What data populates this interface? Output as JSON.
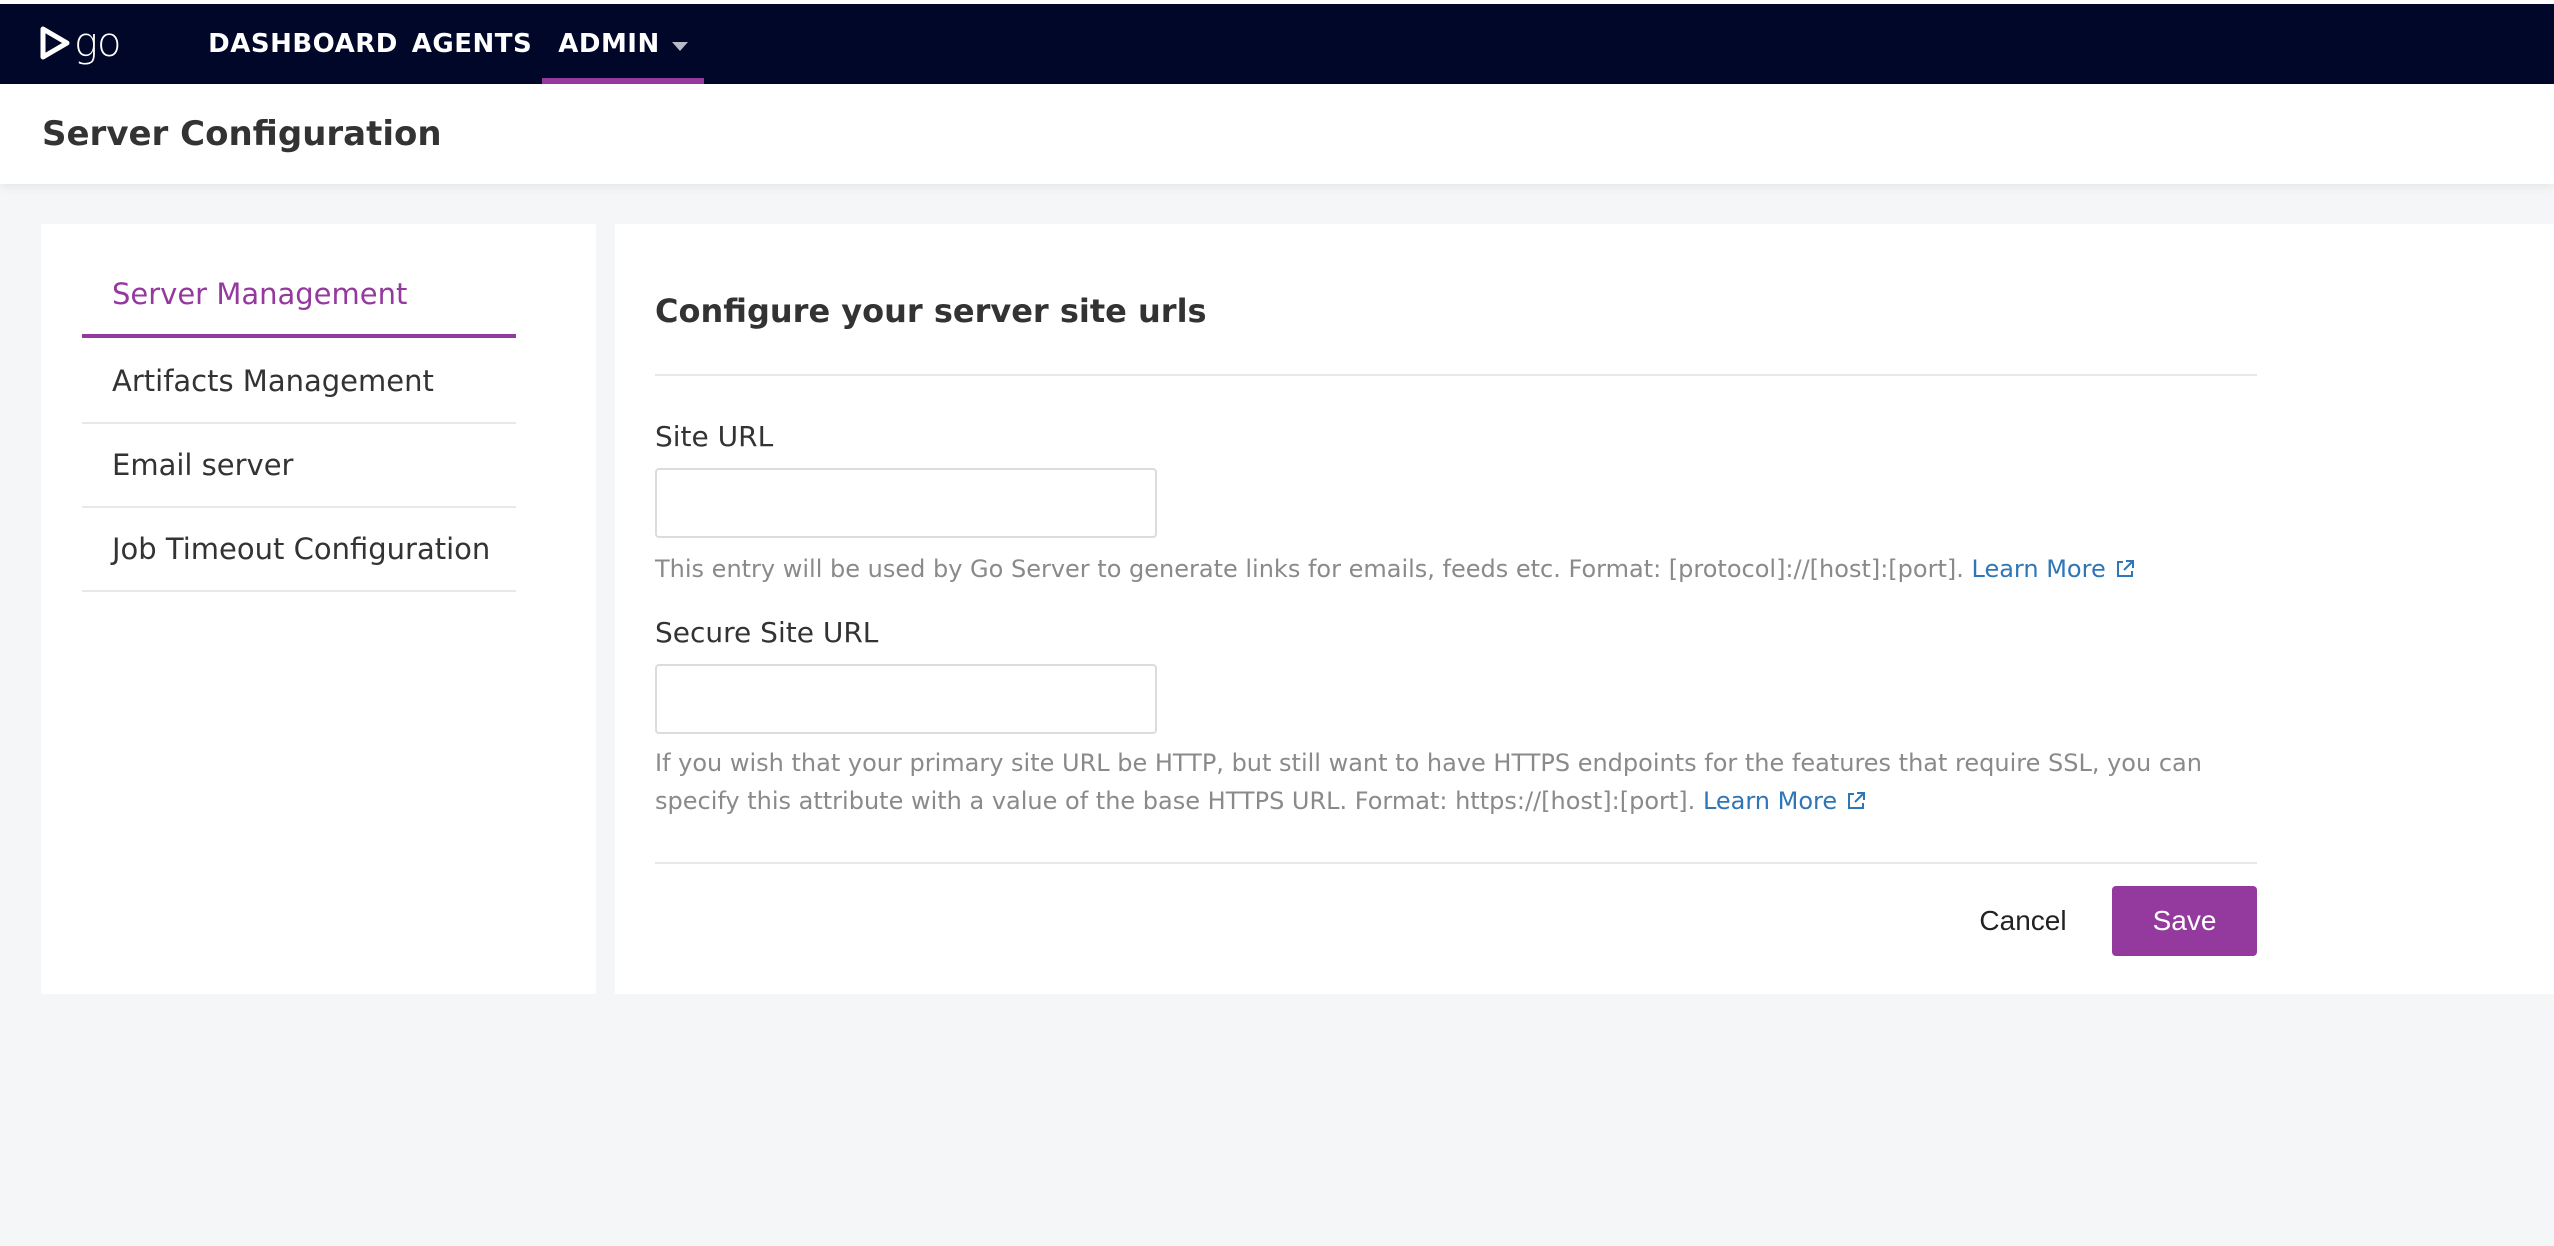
{
  "app": {
    "logo_text": "go",
    "nav": [
      {
        "label": "DASHBOARD"
      },
      {
        "label": "AGENTS"
      },
      {
        "label": "ADMIN"
      }
    ]
  },
  "header": {
    "title": "Server Configuration"
  },
  "sidebar": {
    "items": [
      {
        "label": "Server Management",
        "active": true
      },
      {
        "label": "Artifacts Management"
      },
      {
        "label": "Email server"
      },
      {
        "label": "Job Timeout Configuration"
      }
    ]
  },
  "panel": {
    "title": "Configure your server site urls",
    "site_url": {
      "label": "Site URL",
      "value": "",
      "help": "This entry will be used by Go Server to generate links for emails, feeds etc. Format: [protocol]://[host]:[port].",
      "link": "Learn More"
    },
    "secure_site_url": {
      "label": "Secure Site URL",
      "value": "",
      "help": "If you wish that your primary site URL be HTTP, but still want to have HTTPS endpoints for the features that require SSL, you can specify this attribute with a value of the base HTTPS URL. Format: https://[host]:[port].",
      "link": "Learn More"
    },
    "actions": {
      "cancel": "Cancel",
      "save": "Save"
    }
  },
  "colors": {
    "topbar": "#000728",
    "accent": "#943a9e",
    "link": "#2e76b6"
  }
}
